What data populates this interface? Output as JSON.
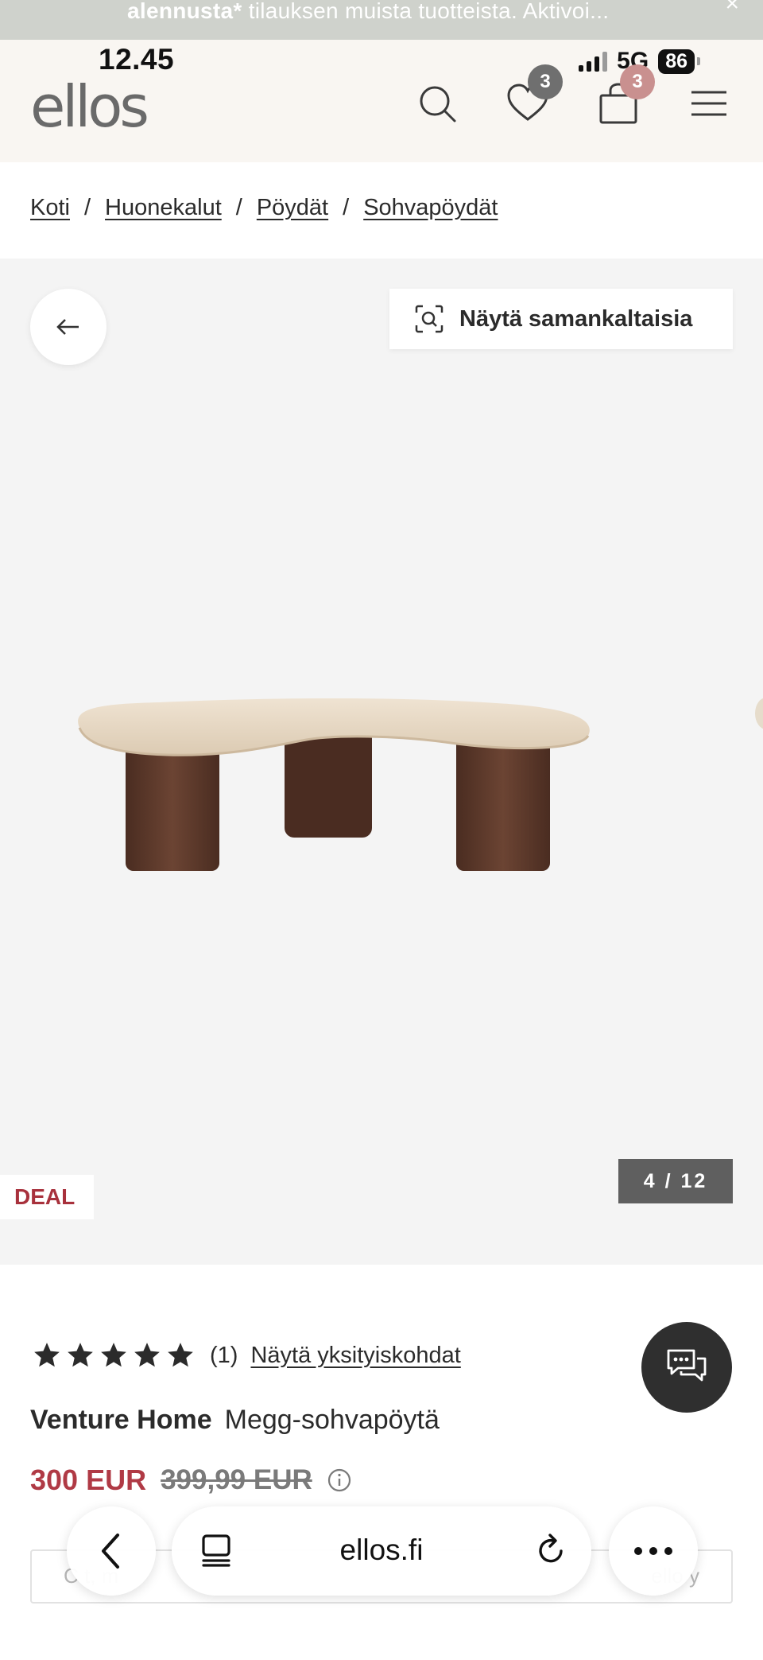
{
  "promo": {
    "bold": "alennusta*",
    "text": " tilauksen muista tuotteista. Aktivoi..."
  },
  "status_bar": {
    "time": "12.45",
    "network": "5G",
    "battery": "86"
  },
  "header": {
    "logo": "ellos",
    "wishlist_count": "3",
    "cart_count": "3",
    "icons": [
      "search-icon",
      "heart-icon",
      "bag-icon",
      "menu-icon"
    ],
    "colors": {
      "wishlist_badge": "#6f6f6f",
      "cart_badge": "#c9908f"
    }
  },
  "breadcrumb": {
    "items": [
      "Koti",
      "Huonekalut",
      "Pöydät",
      "Sohvapöydät"
    ],
    "separator": "/"
  },
  "gallery": {
    "similar_label": "Näytä samankaltaisia",
    "deal_label": "DEAL",
    "counter": "4 / 12",
    "current_index": 4,
    "total": 12
  },
  "product": {
    "rating": 5,
    "review_count": "(1)",
    "details_link": "Näytä yksityiskohdat",
    "brand": "Venture Home",
    "name": "Megg-sohvapöytä",
    "price_now": "300 EUR",
    "price_old": "399,99 EUR",
    "colors": {
      "sale_price": "#b03a45",
      "deal": "#a8313c"
    }
  },
  "underlay": {
    "left_fragment": "C      t, m",
    "right_fragment": "ello      y"
  },
  "browser": {
    "url": "ellos.fi",
    "icons": [
      "back-chevron-icon",
      "tabs-icon",
      "reload-icon",
      "more-icon"
    ]
  }
}
